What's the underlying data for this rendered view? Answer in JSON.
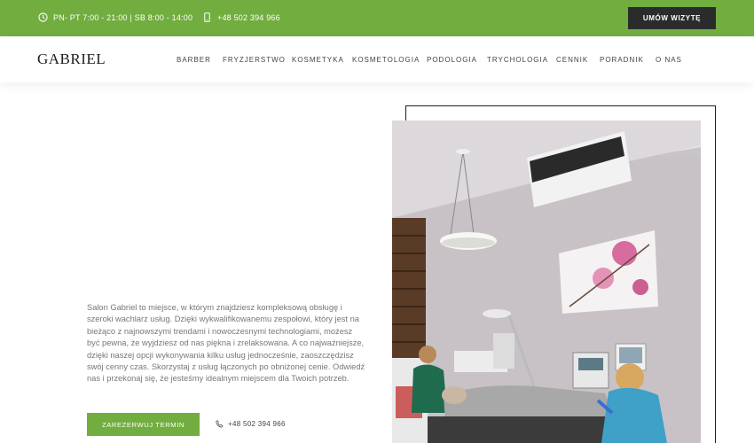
{
  "topbar": {
    "hours": "PN- PT 7:00 - 21:00 | SB 8:00 - 14:00",
    "phone": "+48 502 394 966",
    "cta": "UMÓW WIZYTĘ",
    "bg_color": "#72ad3f"
  },
  "header": {
    "logo": "GABRIEL",
    "nav": [
      "BARBER",
      "FRYZJERSTWO",
      "KOSMETYKA",
      "KOSMETOLOGIA",
      "PODOLOGIA",
      "TRYCHOLOGIA",
      "CENNIK",
      "PORADNIK",
      "O NAS"
    ]
  },
  "hero": {
    "intro": "Salon Gabriel to miejsce, w którym znajdziesz kompleksową obsługę i szeroki wachlarz usług. Dzięki wykwalifikowanemu zespołowi, który jest na bieżąco z najnowszymi trendami i nowoczesnymi technologiami, możesz być pewna, że wyjdziesz od nas piękna i zrelaksowana. A co najważniejsze, dzięki naszej opcji wykonywania kilku usług jednocześnie, zaoszczędzisz swój cenny czas. Skorzystaj z usług łączonych po obniżonej cenie. Odwiedź nas i przekonaj się, że jesteśmy idealnym miejscem dla Twoich potrzeb.",
    "book_label": "ZAREZERWUJ TERMIN",
    "phone": "+48 502 394 966"
  },
  "icons": {
    "clock": "clock-icon",
    "mobile": "mobile-phone-icon",
    "handset": "phone-handset-icon"
  }
}
